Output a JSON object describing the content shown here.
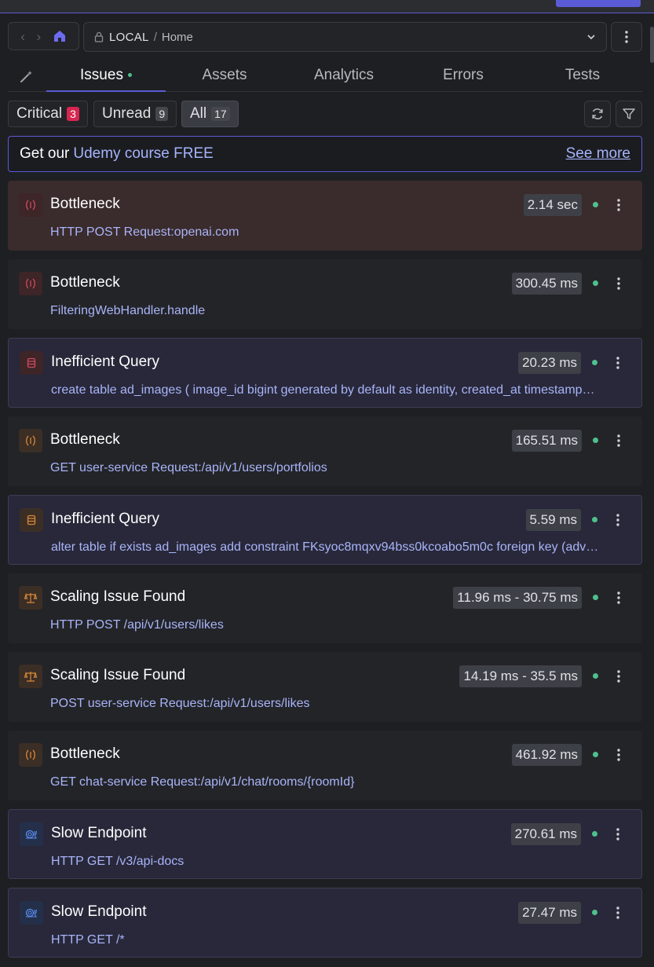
{
  "nav": {
    "back_icon": "chevron-left-icon",
    "forward_icon": "chevron-right-icon",
    "home_icon": "home-icon"
  },
  "location": {
    "env": "LOCAL",
    "separator": "/",
    "path": "Home"
  },
  "tabs": [
    {
      "label": "Issues",
      "active": true
    },
    {
      "label": "Assets",
      "active": false
    },
    {
      "label": "Analytics",
      "active": false
    },
    {
      "label": "Errors",
      "active": false
    },
    {
      "label": "Tests",
      "active": false
    }
  ],
  "filters": [
    {
      "label": "Critical",
      "count": "3"
    },
    {
      "label": "Unread",
      "count": "9"
    },
    {
      "label": "All",
      "count": "17"
    }
  ],
  "promo": {
    "lead": "Get our",
    "link": "Udemy course FREE",
    "more": "See more"
  },
  "issues": [
    {
      "title": "Bottleneck",
      "subtitle": "HTTP POST Request:openai.com",
      "metric": "2.14 sec",
      "icon": "bottleneck-icon"
    },
    {
      "title": "Bottleneck",
      "subtitle": "FilteringWebHandler.handle",
      "metric": "300.45 ms",
      "icon": "bottleneck-icon"
    },
    {
      "title": "Inefficient Query",
      "subtitle": "create table ad_images ( image_id bigint generated by default as identity, created_at timestamp…",
      "metric": "20.23 ms",
      "icon": "database-icon"
    },
    {
      "title": "Bottleneck",
      "subtitle": "GET user-service Request:/api/v1/users/portfolios",
      "metric": "165.51 ms",
      "icon": "bottleneck-icon"
    },
    {
      "title": "Inefficient Query",
      "subtitle": "alter table if exists ad_images add constraint FKsyoc8mqxv94bss0kcoabo5m0c foreign key (adv…",
      "metric": "5.59 ms",
      "icon": "database-icon"
    },
    {
      "title": "Scaling Issue Found",
      "subtitle": "HTTP POST /api/v1/users/likes",
      "metric": "11.96 ms - 30.75 ms",
      "icon": "scale-icon"
    },
    {
      "title": "Scaling Issue Found",
      "subtitle": "POST user-service Request:/api/v1/users/likes",
      "metric": "14.19 ms - 35.5 ms",
      "icon": "scale-icon"
    },
    {
      "title": "Bottleneck",
      "subtitle": "GET chat-service Request:/api/v1/chat/rooms/{roomId}",
      "metric": "461.92 ms",
      "icon": "bottleneck-icon"
    },
    {
      "title": "Slow Endpoint",
      "subtitle": "HTTP GET /v3/api-docs",
      "metric": "270.61 ms",
      "icon": "snail-icon"
    },
    {
      "title": "Slow Endpoint",
      "subtitle": "HTTP GET /*",
      "metric": "27.47 ms",
      "icon": "snail-icon"
    }
  ],
  "colors": {
    "accent": "#5b5bd6",
    "critical_red": "#d7264f",
    "status_green": "#4fc08d",
    "link": "#a5b4fc"
  }
}
